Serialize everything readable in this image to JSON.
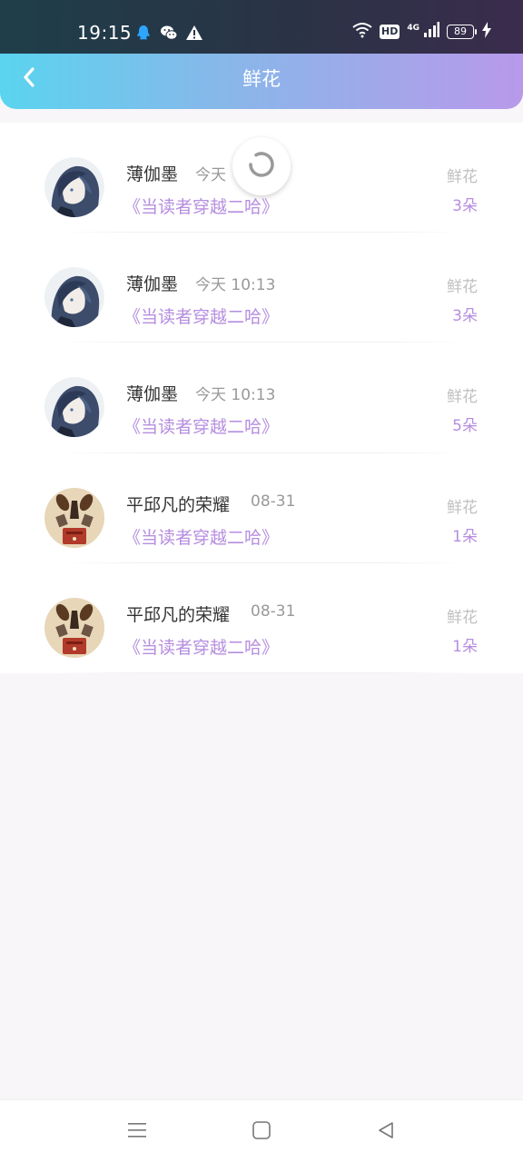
{
  "status_bar": {
    "time": "19:15",
    "left_icons": [
      "qq-icon",
      "wechat-icon",
      "warning-icon"
    ],
    "hd_badge": "HD",
    "network": "4G",
    "battery": "89"
  },
  "header": {
    "title": "鲜花",
    "back_icon": "chevron-left-icon",
    "gradient_start": "#5ad4ef",
    "gradient_end": "#b899ea"
  },
  "records": [
    {
      "user": "薄伽墨",
      "time": "今天 10:13",
      "time_visible": "今天",
      "book": "《当读者穿越二哈》",
      "gift": "鲜花",
      "count": "3朵",
      "avatar": "anime-avatar-blue"
    },
    {
      "user": "薄伽墨",
      "time": "今天 10:13",
      "book": "《当读者穿越二哈》",
      "gift": "鲜花",
      "count": "3朵",
      "avatar": "anime-avatar-blue"
    },
    {
      "user": "薄伽墨",
      "time": "今天 10:13",
      "book": "《当读者穿越二哈》",
      "gift": "鲜花",
      "count": "5朵",
      "avatar": "anime-avatar-blue"
    },
    {
      "user": "平邱凡的荣耀",
      "time": "08-31",
      "book": "《当读者穿越二哈》",
      "gift": "鲜花",
      "count": "1朵",
      "avatar": "illustrated-avatar-beige"
    },
    {
      "user": "平邱凡的荣耀",
      "time": "08-31",
      "book": "《当读者穿越二哈》",
      "gift": "鲜花",
      "count": "1朵",
      "avatar": "illustrated-avatar-beige"
    }
  ],
  "colors": {
    "accent_purple": "#b68ee0",
    "muted_gray": "#c0c0c0",
    "page_bg": "#f8f6f8"
  },
  "loading": {
    "icon": "refresh-spinner-icon"
  },
  "nav_bar": {
    "icons": [
      "menu-icon",
      "home-square-icon",
      "back-triangle-icon"
    ]
  }
}
